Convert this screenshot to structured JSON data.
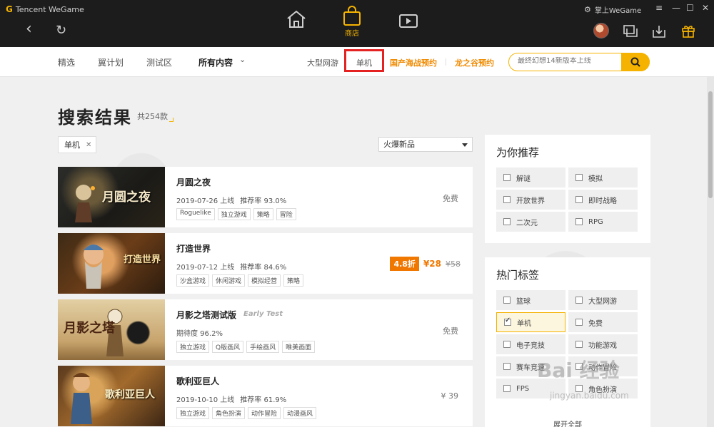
{
  "topbar": {
    "brand": "Tencent WeGame",
    "store_label": "商店",
    "user_label": "掌上WeGame"
  },
  "subnav": {
    "tabs": [
      "精选",
      "翼计划",
      "测试区",
      "所有内容"
    ],
    "mid": [
      "大型网游",
      "单机",
      "国产海战预约",
      "龙之谷预约"
    ],
    "search_placeholder": "最终幻想14新版本上线"
  },
  "results": {
    "title": "搜索结果",
    "count": "共254款",
    "filter": "单机",
    "sort": "火爆新品"
  },
  "games": [
    {
      "name": "月圆之夜",
      "art_text": "月圆之夜",
      "meta": [
        "2019-07-26 上线",
        "推荐率 93.0%"
      ],
      "tags": [
        "Roguelike",
        "独立游戏",
        "策略",
        "冒险"
      ],
      "price": "免费"
    },
    {
      "name": "打造世界",
      "art_text": "打造世界",
      "meta": [
        "2019-07-12 上线",
        "推荐率 84.6%"
      ],
      "tags": [
        "沙盒游戏",
        "休闲游戏",
        "模拟经营",
        "策略"
      ],
      "discount": "4.8折",
      "sale_price": "¥28",
      "orig_price": "¥58"
    },
    {
      "name": "月影之塔测试版",
      "early": "Early Test",
      "art_text": "月影之塔",
      "meta": [
        "期待度 96.2%"
      ],
      "tags": [
        "独立游戏",
        "Q版画风",
        "手绘画风",
        "唯美画面"
      ],
      "price": "免费"
    },
    {
      "name": "歌利亚巨人",
      "art_text": "歌利亚巨人",
      "meta": [
        "2019-10-10 上线",
        "推荐率 61.9%"
      ],
      "tags": [
        "独立游戏",
        "角色扮演",
        "动作冒险",
        "动漫画风"
      ],
      "price": "¥ 39"
    }
  ],
  "recommend": {
    "title": "为你推荐",
    "options": [
      "解谜",
      "模拟",
      "开放世界",
      "即时战略",
      "二次元",
      "RPG"
    ]
  },
  "hot_tags": {
    "title": "热门标签",
    "options": [
      "篮球",
      "大型网游",
      "单机",
      "免费",
      "电子竞技",
      "功能游戏",
      "赛车竞速",
      "动作冒险",
      "FPS",
      "角色扮演"
    ],
    "checked": "单机",
    "more": "展开全部"
  },
  "watermark": {
    "main": "Bai 经验",
    "sub": "jingyan.baidu.com"
  },
  "colors": {
    "accent": "#f5b300",
    "discount": "#f07800",
    "highlight_box": "#e52222",
    "topbar": "#1c1c1c"
  }
}
